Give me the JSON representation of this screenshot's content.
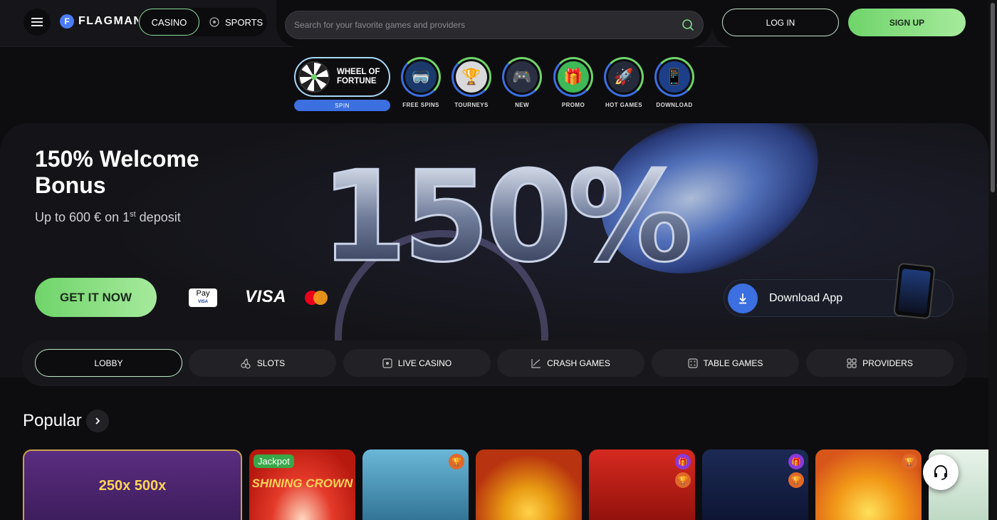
{
  "header": {
    "logo_text": "FLAGMAN",
    "logo_letter": "F",
    "casino_label": "CASINO",
    "sports_label": "SPORTS",
    "search_placeholder": "Search for your favorite games and providers",
    "login_label": "LOG IN",
    "signup_label": "SIGN UP"
  },
  "quicknav": {
    "wheel_title_line1": "WHEEL OF",
    "wheel_title_line2": "FORTUNE",
    "wheel_spin": "SPIN",
    "items": [
      {
        "label": "FREE SPINS",
        "icon": "goggles-icon"
      },
      {
        "label": "TOURNEYS",
        "icon": "trophy-icon"
      },
      {
        "label": "NEW",
        "icon": "gamepad-icon"
      },
      {
        "label": "PROMO",
        "icon": "gift-icon"
      },
      {
        "label": "HOT GAMES",
        "icon": "rocket-icon"
      },
      {
        "label": "DOWNLOAD",
        "icon": "phone-icon"
      }
    ]
  },
  "hero": {
    "title": "150% Welcome Bonus",
    "subtitle_pre": "Up to 600 € on 1",
    "subtitle_sup": "st",
    "subtitle_post": " deposit",
    "big_number": "150%",
    "cta_label": "GET IT NOW",
    "applepay_text": "Pay",
    "applepay_sub": "VISA",
    "visa_text": "VISA",
    "download_label": "Download App"
  },
  "categories": [
    {
      "label": "LOBBY",
      "icon": "",
      "active": true
    },
    {
      "label": "SLOTS",
      "icon": "cherries-icon",
      "active": false
    },
    {
      "label": "LIVE CASINO",
      "icon": "live-icon",
      "active": false
    },
    {
      "label": "CRASH GAMES",
      "icon": "chart-up-icon",
      "active": false
    },
    {
      "label": "TABLE GAMES",
      "icon": "dice-icon",
      "active": false
    },
    {
      "label": "PROVIDERS",
      "icon": "grid-icon",
      "active": false
    }
  ],
  "popular": {
    "title": "Popular",
    "jackpot_label": "Jackpot",
    "game1_text": "250x 500x",
    "game2_title": "SHINING CROWN"
  },
  "colors": {
    "accent_green": "#6fd46a",
    "accent_blue": "#3c6fe0",
    "background": "#0d0d0f"
  }
}
